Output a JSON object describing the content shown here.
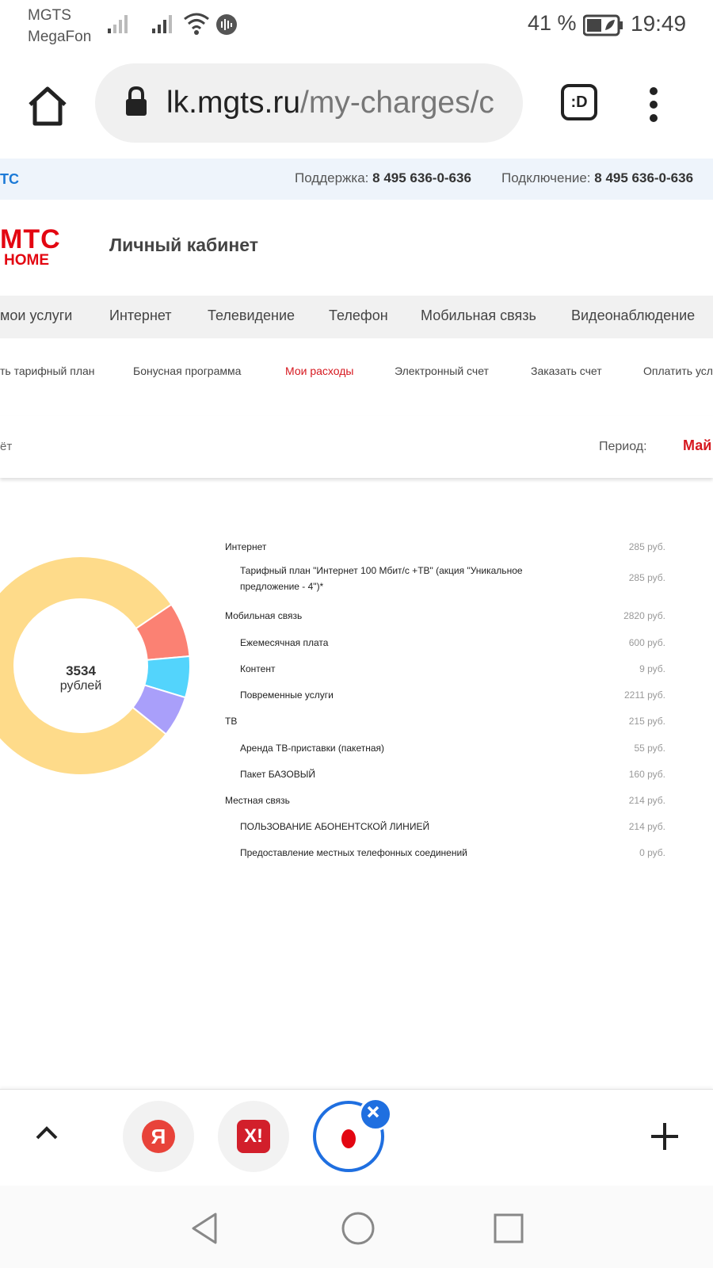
{
  "status_bar": {
    "carrier_1": "MGTS",
    "carrier_2": "MegaFon",
    "battery": "41 %",
    "time": "19:49"
  },
  "browser": {
    "url_host": "lk.mgts.ru",
    "url_path": "/my-charges/c",
    "tab_switch_label": ":D"
  },
  "site": {
    "top_brand": "ТС",
    "support_label": "Поддержка:",
    "support_phone": "8 495 636-0-636",
    "connect_label": "Подключение:",
    "connect_phone": "8 495 636-0-636",
    "logo_line1": "МТС",
    "logo_line2": "HOME",
    "title": "Личный кабинет",
    "main_nav": [
      "мои услуги",
      "Интернет",
      "Телевидение",
      "Телефон",
      "Мобильная связь",
      "Видеонаблюдение"
    ],
    "sub_nav": [
      "ть тарифный план",
      "Бонусная программа",
      "Мои расходы",
      "Электронный счет",
      "Заказать счет",
      "Оплатить усл"
    ],
    "period_left": "ёт",
    "period_label": "Период:",
    "period_value": "Май"
  },
  "chart_data": {
    "type": "pie",
    "center_value": "3534",
    "center_unit": "рублей",
    "categories": [
      "Мобильная связь",
      "Интернет",
      "ТВ",
      "Местная связь"
    ],
    "values": [
      2820,
      285,
      215,
      214
    ],
    "colors": [
      "#fedb8a",
      "#fb8173",
      "#53d4fc",
      "#a99ffa"
    ]
  },
  "breakdown": [
    {
      "name": "Интернет",
      "amount": "285 руб.",
      "level": 0
    },
    {
      "name": "Тарифный план \"Интернет 100 Мбит/с +ТВ\" (акция \"Уникальное предложение - 4\")*",
      "amount": "285 руб.",
      "level": 1
    },
    {
      "name": "Мобильная связь",
      "amount": "2820 руб.",
      "level": 0
    },
    {
      "name": "Ежемесячная плата",
      "amount": "600 руб.",
      "level": 1
    },
    {
      "name": "Контент",
      "amount": "9 руб.",
      "level": 1
    },
    {
      "name": "Повременные услуги",
      "amount": "2211 руб.",
      "level": 1
    },
    {
      "name": "ТВ",
      "amount": "215 руб.",
      "level": 0
    },
    {
      "name": "Аренда ТВ-приставки (пакетная)",
      "amount": "55 руб.",
      "level": 1
    },
    {
      "name": "Пакет БАЗОВЫЙ",
      "amount": "160 руб.",
      "level": 1
    },
    {
      "name": "Местная связь",
      "amount": "214 руб.",
      "level": 0
    },
    {
      "name": "ПОЛЬЗОВАНИЕ АБОНЕНТСКОЙ ЛИНИЕЙ",
      "amount": "214 руб.",
      "level": 1
    },
    {
      "name": "Предоставление местных телефонных соединений",
      "amount": "0 руб.",
      "level": 1
    }
  ],
  "bottom_tabs": {
    "tab1_letter": "Я",
    "tab2_letter": "X!"
  },
  "icons": {
    "home": "home-icon",
    "lock": "lock-icon",
    "menu": "more-vert-icon",
    "back": "back-triangle-icon",
    "home_sys": "home-circle-icon",
    "recents": "recents-square-icon"
  }
}
